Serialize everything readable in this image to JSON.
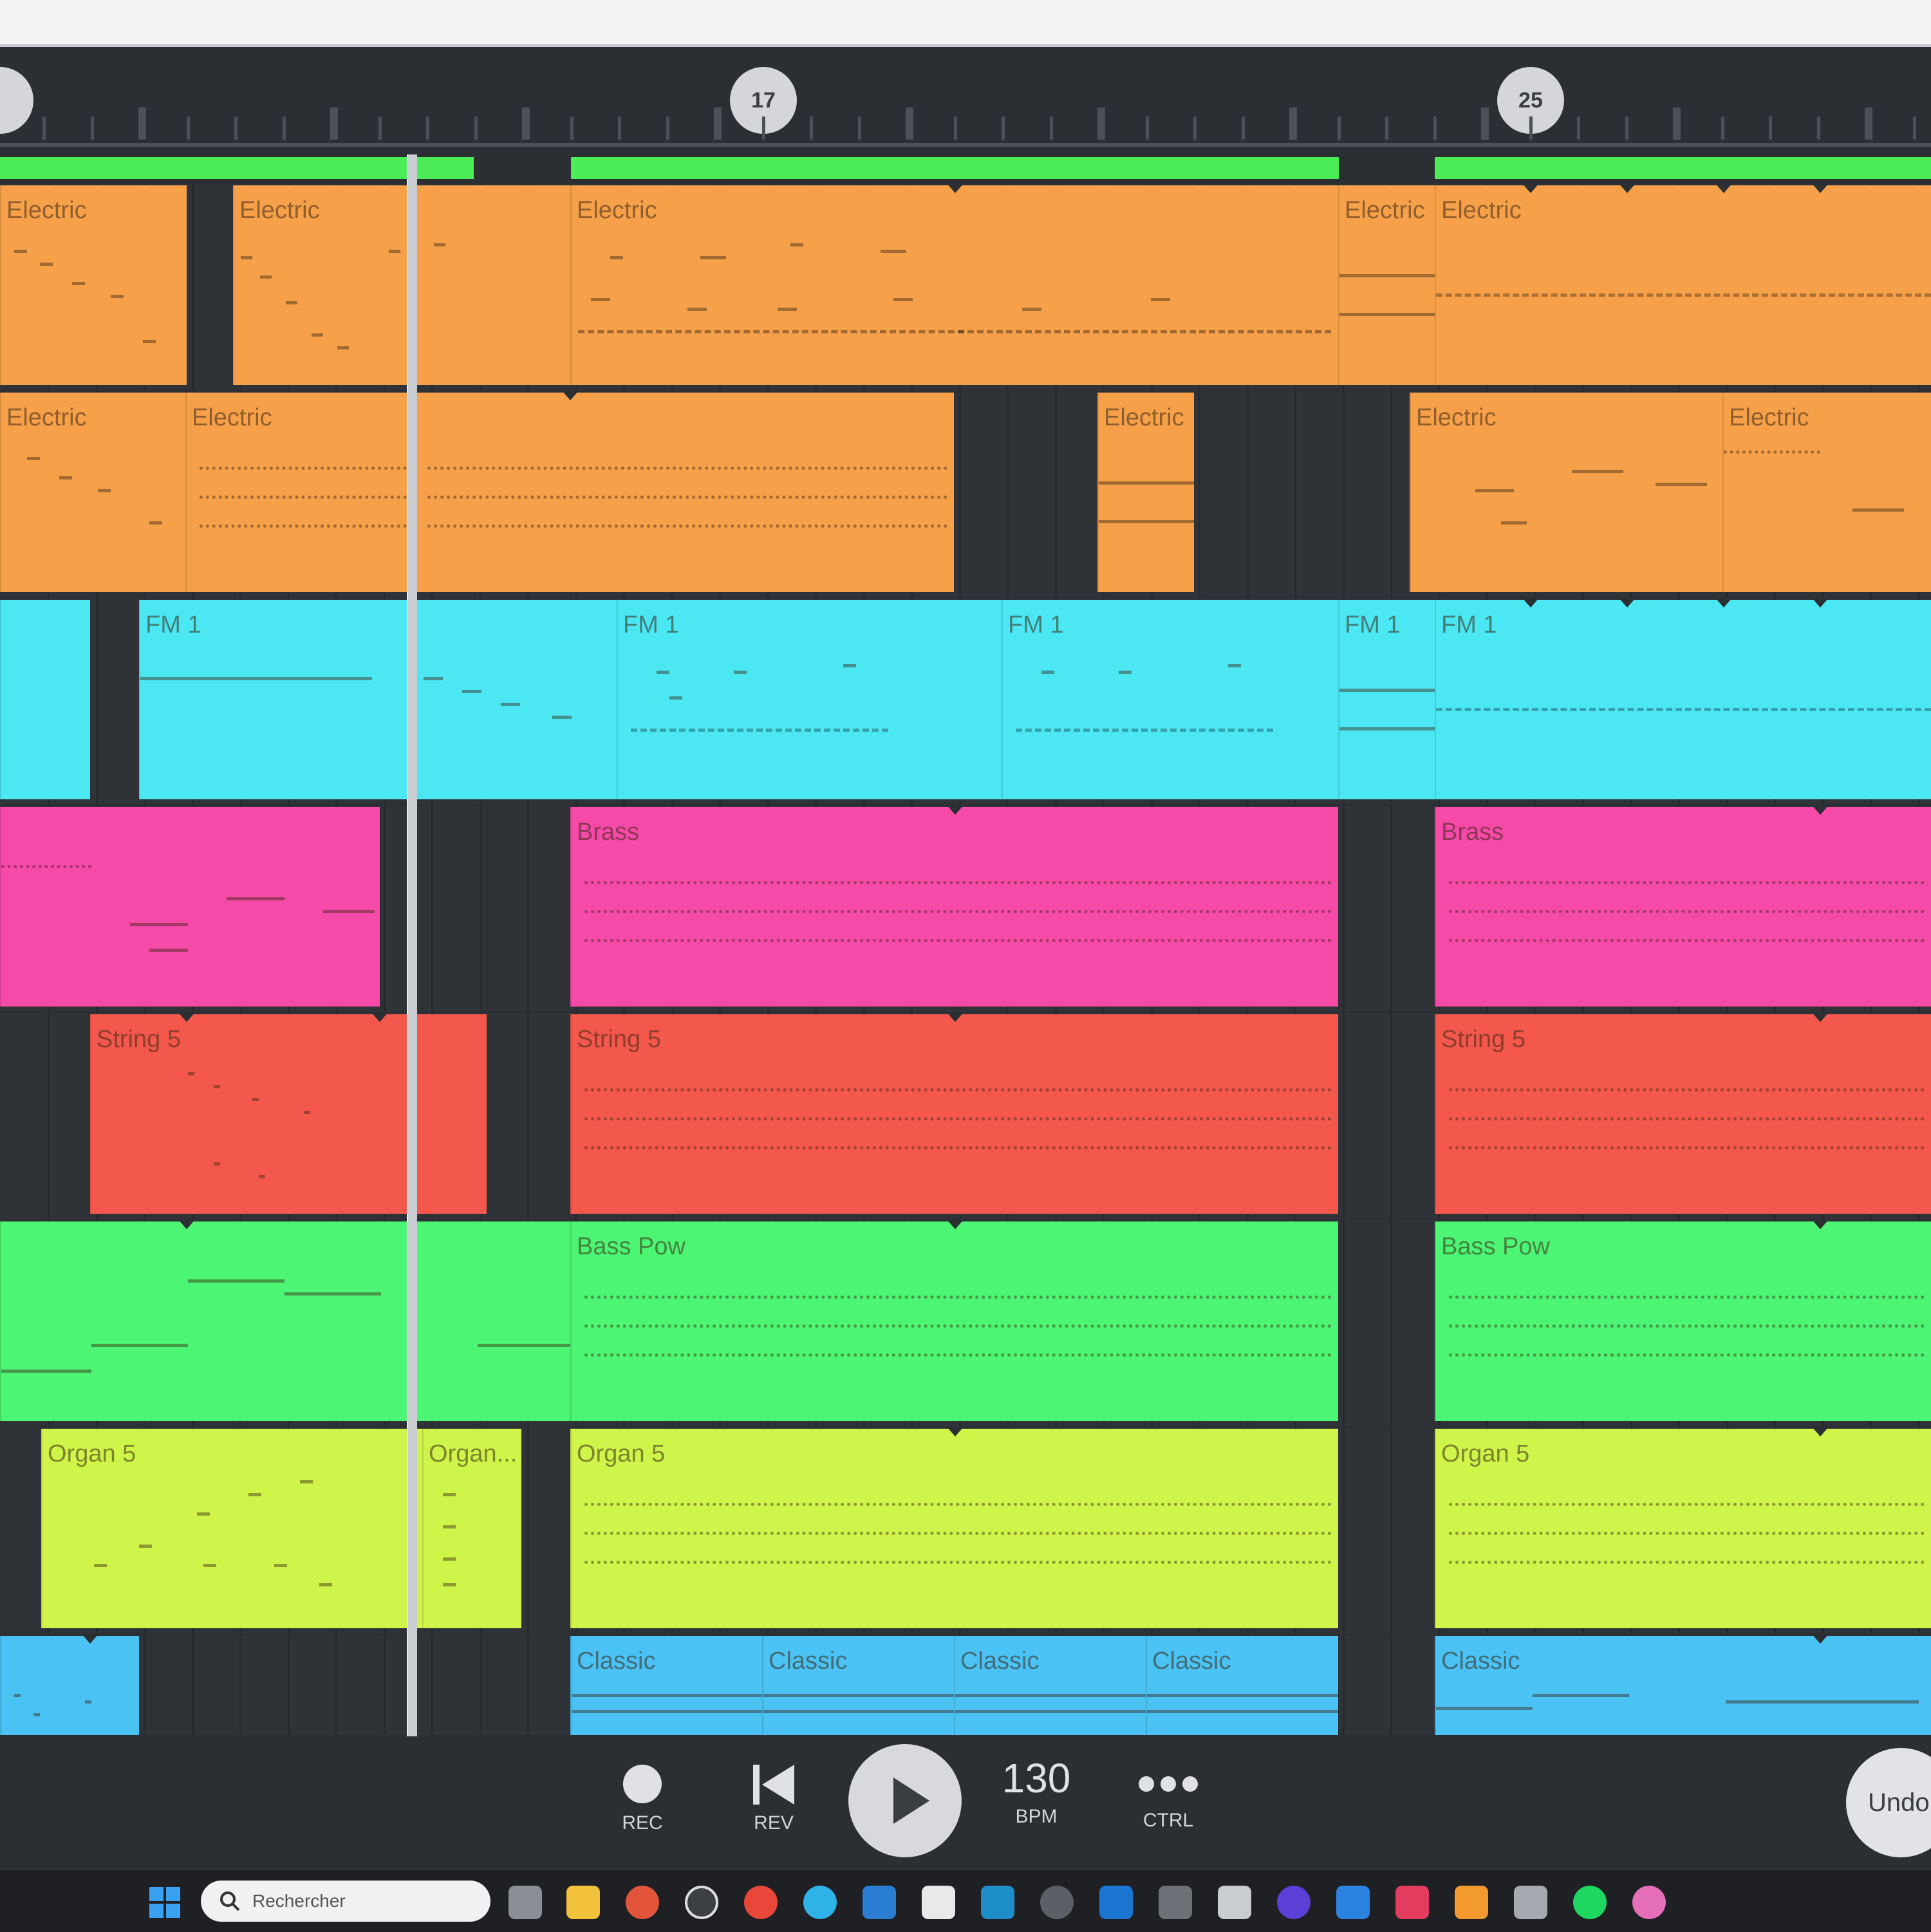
{
  "ruler": {
    "markers": [
      "17",
      "25"
    ]
  },
  "tracks": [
    {
      "color": "#f6a14a",
      "clips": [
        {
          "label": "Electric"
        },
        {
          "label": "Electric"
        },
        {
          "label": "Electric"
        },
        {
          "label": "Electric"
        },
        {
          "label": "Electric"
        }
      ]
    },
    {
      "color": "#f6a14a",
      "clips": [
        {
          "label": "Electric"
        },
        {
          "label": "Electric"
        },
        {
          "label": ""
        },
        {
          "label": "Electric"
        },
        {
          "label": "Electric"
        },
        {
          "label": "Electric"
        }
      ]
    },
    {
      "color": "#4be8f4",
      "clips": [
        {
          "label": ""
        },
        {
          "label": "FM 1"
        },
        {
          "label": "FM 1"
        },
        {
          "label": "FM 1"
        },
        {
          "label": "FM 1"
        },
        {
          "label": "FM 1"
        }
      ]
    },
    {
      "color": "#f64aa8",
      "clips": [
        {
          "label": ""
        },
        {
          "label": "Brass"
        },
        {
          "label": "Brass"
        }
      ]
    },
    {
      "color": "#f4584c",
      "clips": [
        {
          "label": "String 5"
        },
        {
          "label": "String 5"
        },
        {
          "label": "String 5"
        }
      ]
    },
    {
      "color": "#4df574",
      "clips": [
        {
          "label": ""
        },
        {
          "label": "Bass Pow"
        },
        {
          "label": "Bass Pow"
        }
      ]
    },
    {
      "color": "#cff44a",
      "clips": [
        {
          "label": "Organ 5"
        },
        {
          "label": "Organ..."
        },
        {
          "label": "Organ 5"
        },
        {
          "label": "Organ 5"
        }
      ]
    },
    {
      "color": "#4ac2f4",
      "clips": [
        {
          "label": ""
        },
        {
          "label": "Classic"
        },
        {
          "label": "Classic"
        },
        {
          "label": "Classic"
        },
        {
          "label": "Classic"
        },
        {
          "label": "Classic"
        }
      ]
    }
  ],
  "transport": {
    "rec_label": "REC",
    "rev_label": "REV",
    "bpm_value": "130",
    "bpm_label": "BPM",
    "ctrl_label": "CTRL",
    "undo_label": "Undo"
  },
  "taskbar": {
    "search_placeholder": "Rechercher",
    "icons": [
      "windows-start-icon",
      "task-view-icon",
      "file-explorer-icon",
      "app-icon",
      "obs-icon",
      "chrome-icon",
      "edge-icon",
      "vscode-icon",
      "notepad-icon",
      "app-icon",
      "media-icon",
      "outlook-icon",
      "audio-app-icon",
      "snipping-icon",
      "app-icon",
      "music-icon",
      "fl-keys-icon",
      "fl-studio-icon",
      "calculator-icon",
      "spotify-icon",
      "app-icon"
    ]
  }
}
